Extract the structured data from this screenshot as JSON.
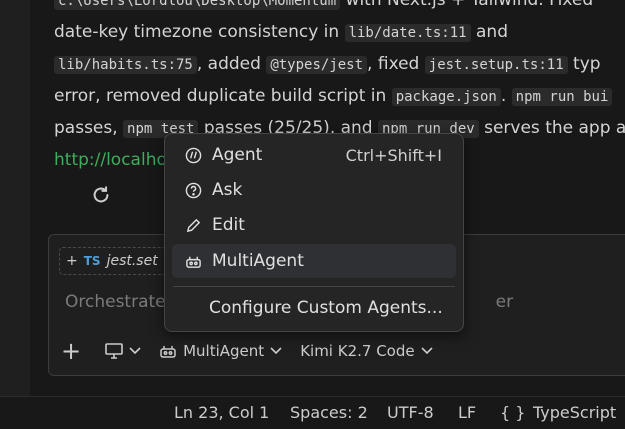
{
  "chat": {
    "message": {
      "line1_pre": "c:\\Users\\Lordlou\\Desktop\\Momentum",
      "line1_post": " with Next.js + Tailwind. Fixed",
      "line2_text": "date-key timezone consistency in ",
      "line2_code": "lib/date.ts:11",
      "line2_post": " and",
      "line3_code1": "lib/habits.ts:75",
      "line3_text1": ", added ",
      "line3_code2": "@types/jest",
      "line3_text2": ", fixed ",
      "line3_code3": "jest.setup.ts:11",
      "line3_text3": " typ",
      "line4_text": "error, removed duplicate build script in ",
      "line4_code1": "package.json",
      "line4_text2": ". ",
      "line4_code2": "npm run bui",
      "line5_text1": "passes, ",
      "line5_code1": "npm test",
      "line5_text2": " passes (25/25), and ",
      "line5_code2": "npm run dev",
      "line5_text3": " serves the app a",
      "link": "http://localho"
    },
    "refresh_icon": "refresh-icon"
  },
  "composer": {
    "chip": {
      "prefix": "+",
      "lang": "TS",
      "name": "jest.set"
    },
    "placeholder_left": "Orchestrate",
    "placeholder_right": "er",
    "toolbar": {
      "add": "+",
      "agent_mode": "MultiAgent",
      "model": "Kimi K2.7 Code"
    }
  },
  "menu": {
    "items": [
      {
        "label": "Agent",
        "shortcut": "Ctrl+Shift+I",
        "icon": "agent-icon"
      },
      {
        "label": "Ask",
        "icon": "ask-icon"
      },
      {
        "label": "Edit",
        "icon": "pencil-icon"
      },
      {
        "label": "MultiAgent",
        "icon": "multiagent-icon",
        "selected": true
      }
    ],
    "configure": "Configure Custom Agents..."
  },
  "status": {
    "position": "Ln 23, Col 1",
    "spaces": "Spaces: 2",
    "encoding": "UTF-8",
    "eol": "LF",
    "braces": "{ }",
    "language": "TypeScript"
  }
}
